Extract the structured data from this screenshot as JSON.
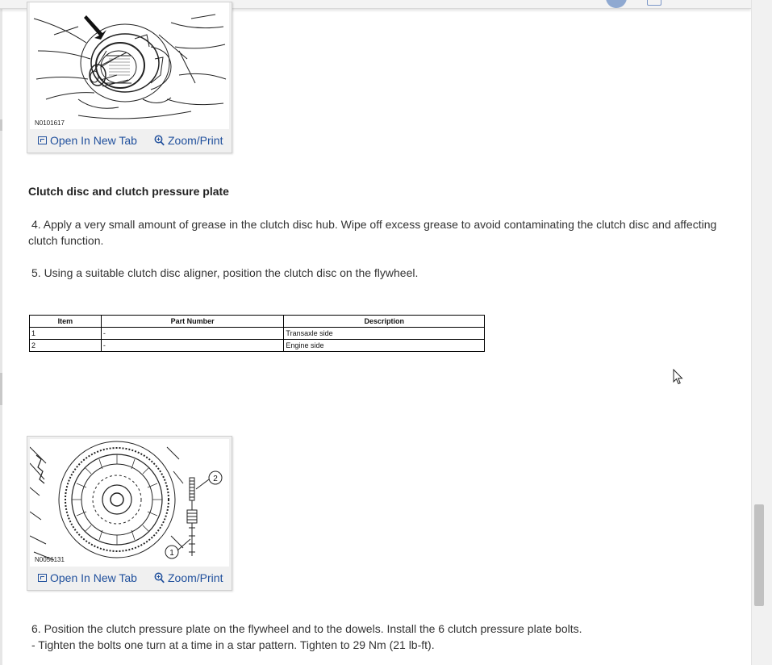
{
  "top_figure": {
    "figure_id": "N0101617",
    "open_label": "Open In New Tab",
    "zoom_label": "Zoom/Print"
  },
  "section": {
    "heading": "Clutch disc and clutch pressure plate"
  },
  "steps": [
    {
      "text": "4. Apply a very small amount of grease in the clutch disc hub. Wipe off excess grease to avoid contaminating the clutch disc and affecting clutch function."
    },
    {
      "text": "5. Using a suitable clutch disc aligner, position the clutch disc on the flywheel."
    },
    {
      "text": "6. Position the clutch pressure plate on the flywheel and to the dowels. Install the 6 clutch pressure plate bolts."
    }
  ],
  "step6_sub": "-  Tighten the bolts one turn at a time in a star pattern. Tighten to 29 Nm (21 lb-ft).",
  "parts_table": {
    "headers": [
      "Item",
      "Part Number",
      "Description"
    ],
    "rows": [
      [
        "1",
        "-",
        "Transaxle side"
      ],
      [
        "2",
        "-",
        "Engine side"
      ]
    ]
  },
  "bottom_figure": {
    "figure_id": "N0056131",
    "callouts": [
      "1",
      "2"
    ],
    "open_label": "Open In New Tab",
    "zoom_label": "Zoom/Print"
  },
  "icons": {
    "open": "open-in-new-tab-icon",
    "zoom": "magnifier-zoom-icon",
    "cursor": "mouse-pointer"
  },
  "colors": {
    "link": "#1f4f9c",
    "text": "#333333",
    "header_circle": "#8fa9d1"
  }
}
